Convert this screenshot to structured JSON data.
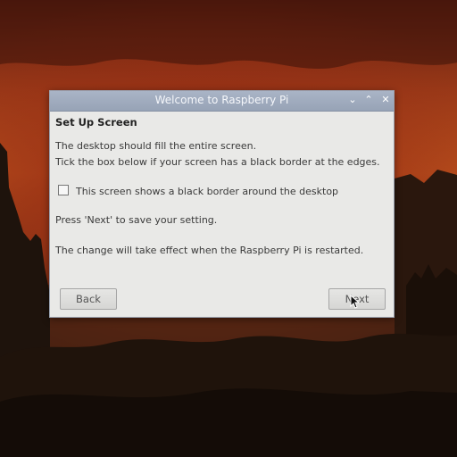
{
  "window": {
    "title": "Welcome to Raspberry Pi",
    "controls": {
      "minimize": "⌄",
      "maximize": "⌃",
      "close": "✕"
    }
  },
  "page": {
    "heading": "Set Up Screen",
    "description_line1": "The desktop should fill the entire screen.",
    "description_line2": "Tick the box below if your screen has a black border at the edges.",
    "checkbox_label": "This screen shows a black border around the desktop",
    "checkbox_checked": false,
    "hint": "Press 'Next' to save your setting.",
    "note": "The change will take effect when the Raspberry Pi is restarted."
  },
  "buttons": {
    "back": "Back",
    "next": "Next"
  }
}
